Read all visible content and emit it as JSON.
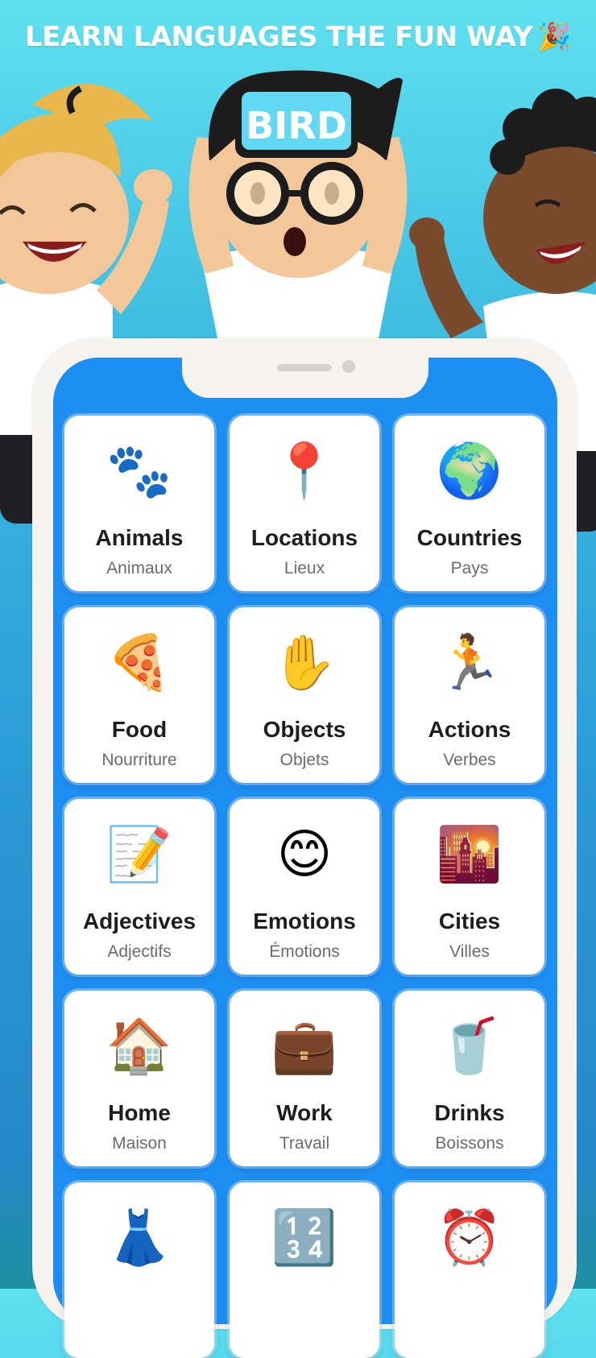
{
  "header": {
    "headline": "LEARN LANGUAGES THE FUN WAY",
    "headline_emoji": "🎉"
  },
  "illustration": {
    "forehead_card_text": "BIRD"
  },
  "colors": {
    "screen_blue": "#1e8ff2",
    "frame": "#f6f3ee",
    "card": "#ffffff"
  },
  "categories": [
    {
      "icon": "🐾",
      "icon_name": "paw-prints-icon",
      "title": "Animals",
      "subtitle": "Animaux"
    },
    {
      "icon": "📍",
      "icon_name": "pushpin-icon",
      "title": "Locations",
      "subtitle": "Lieux"
    },
    {
      "icon": "🌍",
      "icon_name": "globe-icon",
      "title": "Countries",
      "subtitle": "Pays"
    },
    {
      "icon": "🍕",
      "icon_name": "pizza-icon",
      "title": "Food",
      "subtitle": "Nourriture"
    },
    {
      "icon": "✋",
      "icon_name": "raised-hand-icon",
      "title": "Objects",
      "subtitle": "Objets"
    },
    {
      "icon": "🏃",
      "icon_name": "running-person-icon",
      "title": "Actions",
      "subtitle": "Verbes"
    },
    {
      "icon": "📝",
      "icon_name": "memo-pencil-icon",
      "title": "Adjectives",
      "subtitle": "Adjectifs"
    },
    {
      "icon": "😊",
      "icon_name": "smiling-face-icon",
      "title": "Emotions",
      "subtitle": "Émotions"
    },
    {
      "icon": "🌇",
      "icon_name": "city-sunset-icon",
      "title": "Cities",
      "subtitle": "Villes"
    },
    {
      "icon": "🏠",
      "icon_name": "house-icon",
      "title": "Home",
      "subtitle": "Maison"
    },
    {
      "icon": "💼",
      "icon_name": "briefcase-icon",
      "title": "Work",
      "subtitle": "Travail"
    },
    {
      "icon": "🥤",
      "icon_name": "cup-with-straw-icon",
      "title": "Drinks",
      "subtitle": "Boissons"
    },
    {
      "icon": "👗",
      "icon_name": "dress-icon",
      "title": "",
      "subtitle": ""
    },
    {
      "icon": "🔢",
      "icon_name": "numbers-icon",
      "title": "",
      "subtitle": ""
    },
    {
      "icon": "⏰",
      "icon_name": "alarm-clock-icon",
      "title": "",
      "subtitle": ""
    }
  ]
}
